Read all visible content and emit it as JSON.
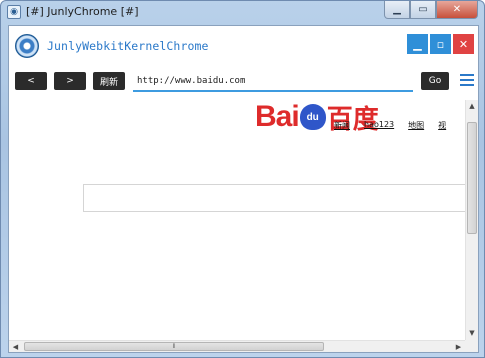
{
  "os_window": {
    "title": "[#] JunlyChrome [#]",
    "app_icon": "window-app-icon",
    "controls": [
      {
        "name": "minimize",
        "glyph": "▁"
      },
      {
        "name": "maximize",
        "glyph": "▭"
      },
      {
        "name": "close",
        "glyph": "✕"
      }
    ]
  },
  "app": {
    "title": "JunlyWebkitKernelChrome",
    "logo_icon": "browser-logo-icon",
    "window_controls": {
      "minimize": "▁",
      "maximize": "▫",
      "close": "✕"
    }
  },
  "toolbar": {
    "back_label": "<",
    "forward_label": ">",
    "refresh_label": "刷新",
    "url_value": "http://www.baidu.com",
    "go_label": "Go",
    "menu_icon": "hamburger-menu-icon"
  },
  "webpage": {
    "logo": {
      "bai": "Bai",
      "paw": "du",
      "cn": "百度"
    },
    "nav_links": [
      "新闻",
      "hao123",
      "地图",
      "视"
    ],
    "search_value": ""
  },
  "scrollbars": {
    "up": "▲",
    "down": "▼",
    "left": "◀",
    "right": "▶",
    "grip": "⦀"
  },
  "colors": {
    "accent_blue": "#2f8fd8",
    "close_red": "#e04343",
    "baidu_red": "#de2b2b",
    "baidu_blue": "#2f56c9"
  }
}
